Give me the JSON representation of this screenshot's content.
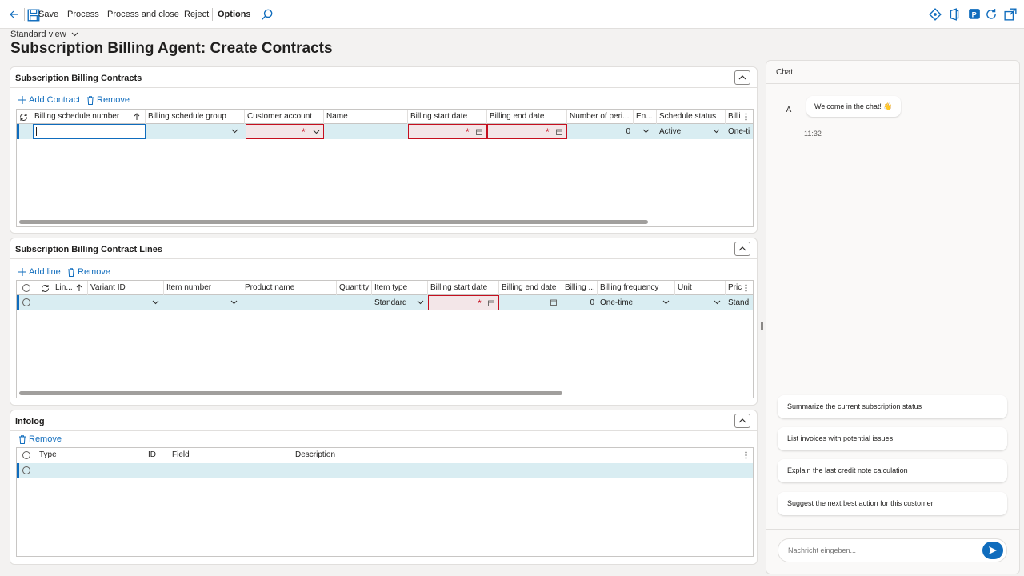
{
  "toolbar": {
    "save": "Save",
    "process": "Process",
    "process_close": "Process and close",
    "reject": "Reject",
    "options": "Options"
  },
  "page": {
    "view": "Standard view",
    "title": "Subscription Billing Agent: Create Contracts"
  },
  "contracts": {
    "title": "Subscription Billing Contracts",
    "add": "Add Contract",
    "remove": "Remove",
    "headers": [
      "Billing schedule number",
      "Billing schedule group",
      "Customer account",
      "Name",
      "Billing start date",
      "Billing end date",
      "Number of peri...",
      "En...",
      "Schedule status",
      "Billi"
    ],
    "row": {
      "periods": "0",
      "status": "Active",
      "billing": "One-ti"
    }
  },
  "lines": {
    "title": "Subscription Billing Contract Lines",
    "add": "Add line",
    "remove": "Remove",
    "headers": [
      "Lin...",
      "Variant ID",
      "Item number",
      "Product name",
      "Quantity",
      "Item type",
      "Billing start date",
      "Billing end date",
      "Billing ...",
      "Billing frequency",
      "Unit",
      "Pric"
    ],
    "row": {
      "item_type": "Standard",
      "billing_qty": "0",
      "frequency": "One-time",
      "price": "Stand."
    }
  },
  "infolog": {
    "title": "Infolog",
    "remove": "Remove",
    "headers": [
      "Type",
      "ID",
      "Field",
      "Description"
    ]
  },
  "chat": {
    "title": "Chat",
    "avatar": "A",
    "welcome": "Welcome in the chat! 👋",
    "time": "11:32",
    "suggestions": [
      "Summarize the current subscription status",
      "List invoices with potential issues",
      "Explain the last credit note calculation",
      "Suggest the next best action for this customer"
    ],
    "placeholder": "Nachricht eingeben..."
  },
  "colors": {
    "accent": "#0f6cbd",
    "error": "#c50f1f",
    "row_selected": "#d9edf2"
  }
}
